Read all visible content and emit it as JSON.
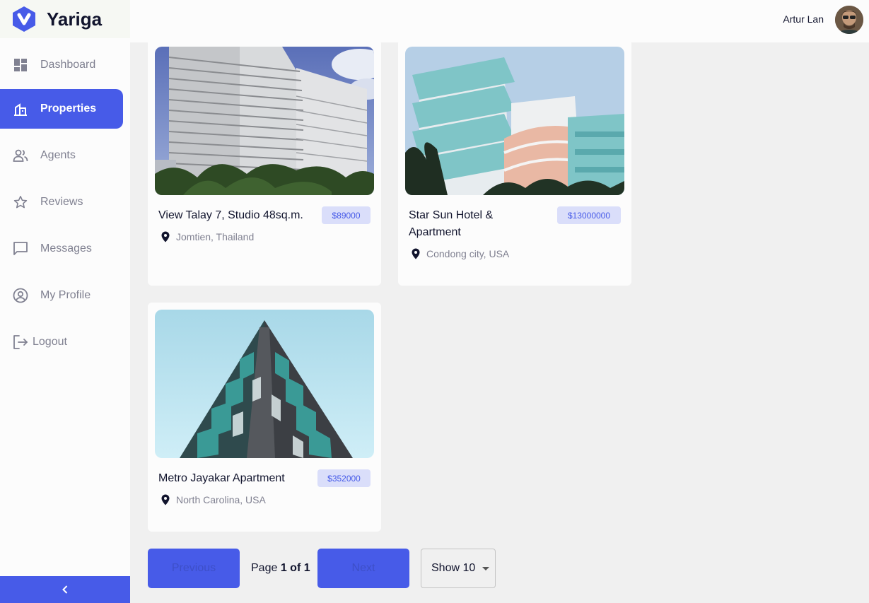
{
  "brand": {
    "name": "Yariga"
  },
  "sidebar": {
    "items": [
      {
        "label": "Dashboard",
        "icon": "dashboard-icon"
      },
      {
        "label": "Properties",
        "icon": "properties-icon"
      },
      {
        "label": "Agents",
        "icon": "agents-icon"
      },
      {
        "label": "Reviews",
        "icon": "star-icon"
      },
      {
        "label": "Messages",
        "icon": "message-icon"
      },
      {
        "label": "My Profile",
        "icon": "profile-icon"
      },
      {
        "label": "Logout",
        "icon": "logout-icon"
      }
    ],
    "active": "Properties",
    "collapse_icon": "chevron-left-icon"
  },
  "header": {
    "user_name": "Artur Lan"
  },
  "properties": [
    {
      "title": "View Talay 7, Studio 48sq.m.",
      "price": "$89000",
      "location": "Jomtien, Thailand"
    },
    {
      "title_line1": "Star Sun Hotel &",
      "title_line2": "Apartment",
      "price": "$13000000",
      "location": "Condong city, USA"
    },
    {
      "title": "Metro Jayakar Apartment",
      "price": "$352000",
      "location": "North Carolina, USA"
    }
  ],
  "pagination": {
    "previous_label": "Previous",
    "next_label": "Next",
    "page_prefix": "Page",
    "page_value": "1 of 1",
    "page_size_label": "Show 10"
  },
  "colors": {
    "accent": "#475be8",
    "price_bg": "#dadefa",
    "muted": "#808191"
  }
}
